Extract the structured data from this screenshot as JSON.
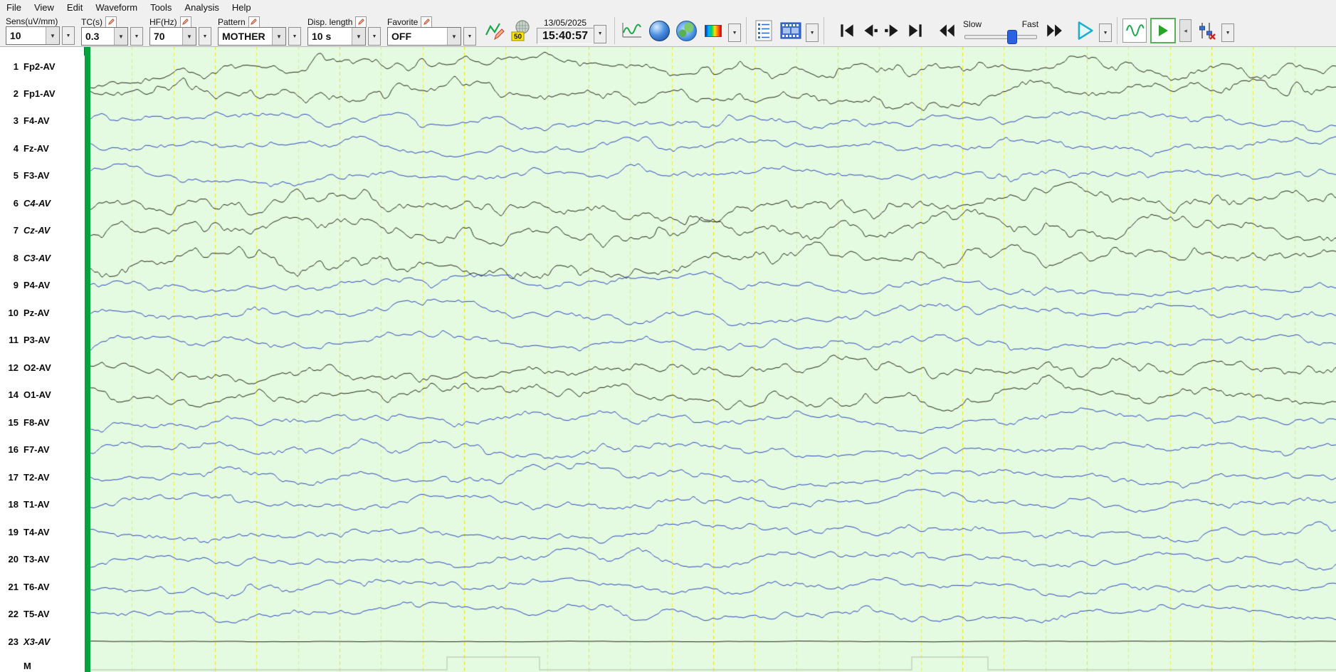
{
  "menu": {
    "items": [
      "File",
      "View",
      "Edit",
      "Waveform",
      "Tools",
      "Analysis",
      "Help"
    ]
  },
  "icons": {
    "dropdown": "▼",
    "thin_arrow": "◂"
  },
  "toolbar": {
    "sens": {
      "label": "Sens(uV/mm)",
      "value": "10"
    },
    "tc": {
      "label": "TC(s)",
      "value": "0.3"
    },
    "hf": {
      "label": "HF(Hz)",
      "value": "70"
    },
    "pattern": {
      "label": "Pattern",
      "value": "MOTHER"
    },
    "disp": {
      "label": "Disp. length",
      "value": "10 s"
    },
    "favorite": {
      "label": "Favorite",
      "value": "OFF"
    },
    "notch_badge": "50",
    "datetime": {
      "date": "13/05/2025",
      "time": "15:40:57"
    },
    "speed": {
      "slow": "Slow",
      "fast": "Fast"
    }
  },
  "channels": [
    {
      "num": "1",
      "label": "Fp2-AV",
      "color": "black",
      "italic": false
    },
    {
      "num": "2",
      "label": "Fp1-AV",
      "color": "black",
      "italic": false
    },
    {
      "num": "3",
      "label": "F4-AV",
      "color": "blue",
      "italic": false
    },
    {
      "num": "4",
      "label": "Fz-AV",
      "color": "blue",
      "italic": false
    },
    {
      "num": "5",
      "label": "F3-AV",
      "color": "blue",
      "italic": false
    },
    {
      "num": "6",
      "label": "C4-AV",
      "color": "black",
      "italic": true
    },
    {
      "num": "7",
      "label": "Cz-AV",
      "color": "black",
      "italic": true
    },
    {
      "num": "8",
      "label": "C3-AV",
      "color": "black",
      "italic": true
    },
    {
      "num": "9",
      "label": "P4-AV",
      "color": "blue",
      "italic": false
    },
    {
      "num": "10",
      "label": "Pz-AV",
      "color": "blue",
      "italic": false
    },
    {
      "num": "11",
      "label": "P3-AV",
      "color": "blue",
      "italic": false
    },
    {
      "num": "12",
      "label": "O2-AV",
      "color": "black",
      "italic": false
    },
    {
      "num": "14",
      "label": "O1-AV",
      "color": "black",
      "italic": false
    },
    {
      "num": "15",
      "label": "F8-AV",
      "color": "blue",
      "italic": false
    },
    {
      "num": "16",
      "label": "F7-AV",
      "color": "blue",
      "italic": false
    },
    {
      "num": "17",
      "label": "T2-AV",
      "color": "blue",
      "italic": false
    },
    {
      "num": "18",
      "label": "T1-AV",
      "color": "blue",
      "italic": false
    },
    {
      "num": "19",
      "label": "T4-AV",
      "color": "blue",
      "italic": false
    },
    {
      "num": "20",
      "label": "T3-AV",
      "color": "blue",
      "italic": false
    },
    {
      "num": "21",
      "label": "T6-AV",
      "color": "blue",
      "italic": false
    },
    {
      "num": "22",
      "label": "T5-AV",
      "color": "blue",
      "italic": false
    },
    {
      "num": "23",
      "label": "X3-AV",
      "color": "black",
      "italic": true
    }
  ],
  "marker": {
    "label": "M"
  },
  "wave_area": {
    "bg": "#e4fbe1",
    "grid_color": "#f2e300",
    "trace_blue": "#2f46c0",
    "trace_black": "#24241a",
    "marker_color": "#c2cfba",
    "strip_color": "#00a33c",
    "strip_cap_color": "#00c050",
    "display_seconds": 10
  }
}
